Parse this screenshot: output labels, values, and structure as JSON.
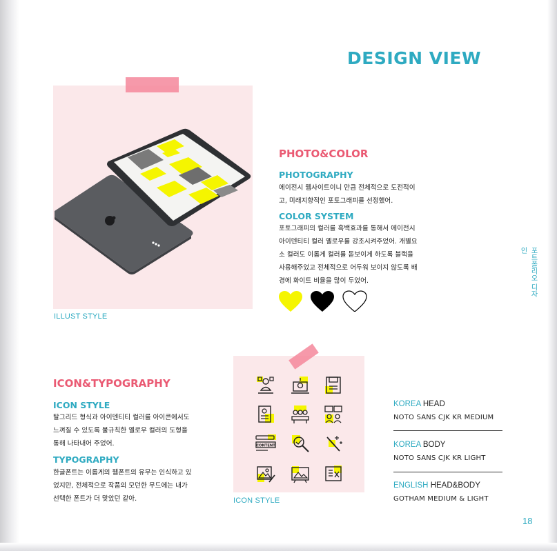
{
  "header": {
    "title": "DESIGN VIEW"
  },
  "side_label": "포트폴리오 디자인",
  "page_number": "18",
  "colors": {
    "accent_blue": "#2eaac1",
    "accent_pink": "#ea5a73",
    "panel": "#fbe8ea",
    "yellow": "#f5f500"
  },
  "illust": {
    "caption": "ILLUST STYLE"
  },
  "photo_color": {
    "title": "PHOTO&COLOR",
    "photography_title": "PHOTOGRAPHY",
    "photography_lines": [
      "에이전시 웹사이트이니 만큼 전체적으로 도전적이",
      "고, 미래지향적인 포토그래피를 선정했어."
    ],
    "color_title": "COLOR SYSTEM",
    "color_lines": [
      "포토그래피의 컬러를 흑백효과를 통해서 에이전시",
      "아이덴티티 컬러 옐로우를 강조시켜주었어. 개별요",
      "소 컬러도 이롭게 컬러를 돋보이게 하도록 블랙을",
      "사용해주었고 전체적으로 어두워 보이지 않도록 배",
      "경에 화이트 비율을 많이 두었어."
    ],
    "swatches": [
      {
        "name": "yellow-heart-icon",
        "color": "#f5f500"
      },
      {
        "name": "black-heart-icon",
        "color": "#000000"
      },
      {
        "name": "white-heart-icon",
        "color": "#ffffff"
      }
    ]
  },
  "icon_typo": {
    "title": "ICON&TYPOGRAPHY",
    "icon_style_title": "ICON STYLE",
    "icon_style_lines": [
      "탈그리드 형식과 아이덴티티 컬러를 아이콘에서도",
      "느껴질 수 있도록 불규칙한 옐로우 컬러의 도형을",
      "통해 나타내어 주었어."
    ],
    "typography_title": "TYPOGRAPHY",
    "typography_lines": [
      "한글폰트는 이롭게의 웹폰트의 유무는 인식하고 있",
      "었지만, 전체적으로 작품의 모던한 무드에는 내가",
      "선택한 폰트가 더 맞았던 같아."
    ],
    "icon_caption": "ICON STYLE",
    "icon_content_label": "CONTENT"
  },
  "typography_specs": [
    {
      "highlight": "KOREA",
      "rest": " HEAD",
      "font": "NOTO SANS CJK KR MEDIUM"
    },
    {
      "highlight": "KOREA",
      "rest": " BODY",
      "font": "NOTO SANS CJK KR LIGHT"
    },
    {
      "highlight": "ENGLISH",
      "rest": " HEAD&BODY",
      "font": "GOTHAM MEDIUM & LIGHT"
    }
  ]
}
